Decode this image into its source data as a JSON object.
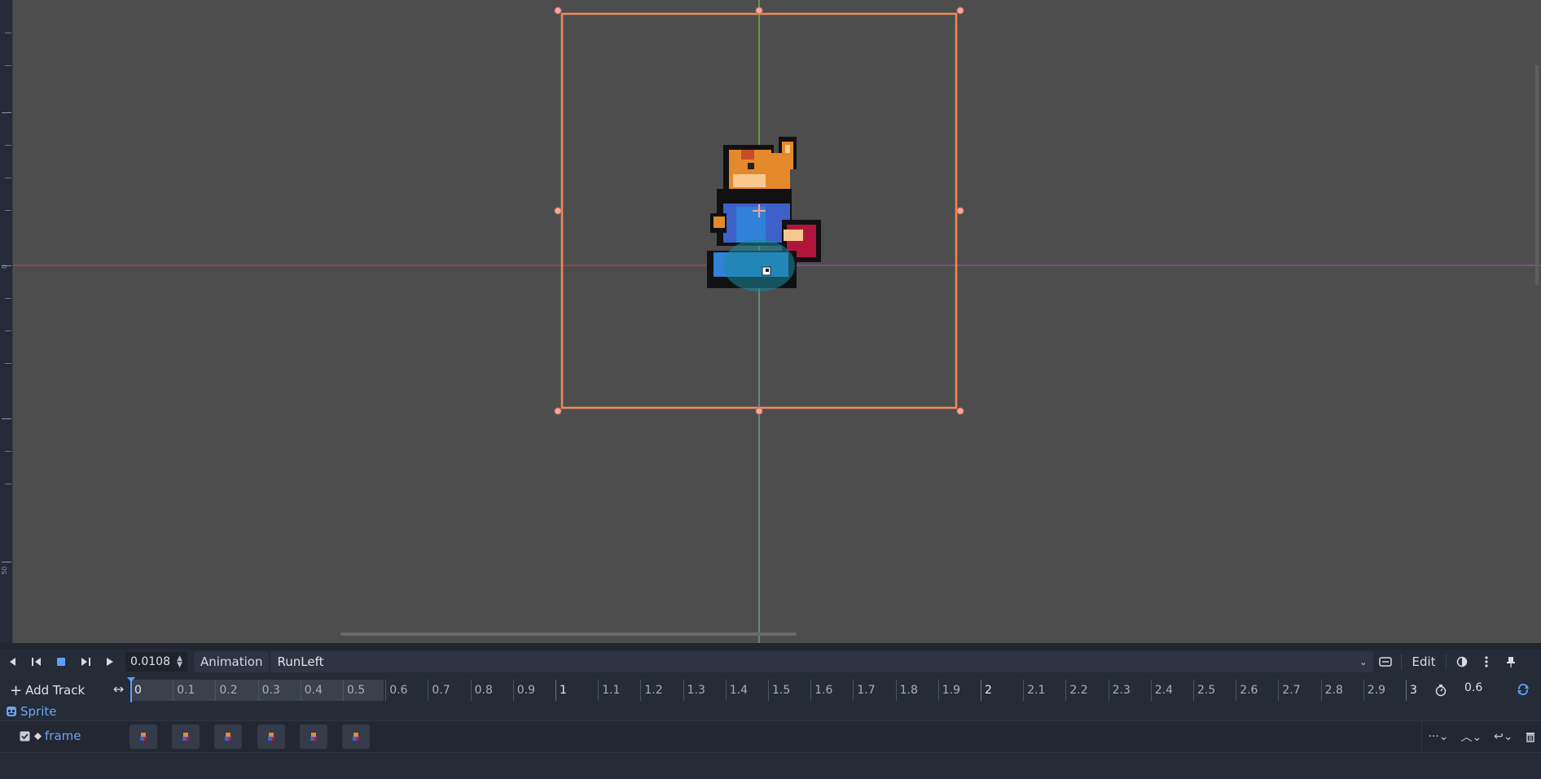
{
  "viewport": {
    "ruler_labels": [
      "0",
      "50"
    ]
  },
  "playback": {
    "time_value": "0.0108"
  },
  "animation": {
    "menu_label": "Animation",
    "current": "RunLeft",
    "edit_label": "Edit"
  },
  "timeline": {
    "add_track_label": "Add Track",
    "ticks": [
      "0",
      "0.1",
      "0.2",
      "0.3",
      "0.4",
      "0.5",
      "0.6",
      "0.7",
      "0.8",
      "0.9",
      "1",
      "1.1",
      "1.2",
      "1.3",
      "1.4",
      "1.5",
      "1.6",
      "1.7",
      "1.8",
      "1.9",
      "2",
      "2.1",
      "2.2",
      "2.3",
      "2.4",
      "2.5",
      "2.6",
      "2.7",
      "2.8",
      "2.9",
      "3"
    ],
    "length": "0.6"
  },
  "tracks": {
    "node_name": "Sprite",
    "property_name": "frame",
    "keyframe_count": 6
  },
  "icons": [
    "to-start-icon",
    "step-back-icon",
    "stop-icon",
    "step-forward-icon",
    "play-icon",
    "spin-icon",
    "track-filter-icon",
    "onion-skin-icon",
    "more-icon",
    "pin-icon",
    "add-icon",
    "fit-icon",
    "timer-icon",
    "loop-icon",
    "sprite-node-icon",
    "checkbox-icon",
    "key-icon",
    "interp-icon",
    "update-mode-icon",
    "wrap-icon",
    "delete-icon"
  ],
  "colors": {
    "accent": "#5aa0ff",
    "selection": "#f08a5a",
    "x_axis": "#e0405a",
    "y_axis": "#60c040"
  }
}
